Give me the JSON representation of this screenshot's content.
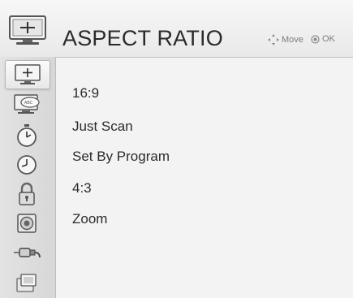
{
  "header": {
    "title": "ASPECT RATIO",
    "hint_move": "Move",
    "hint_ok": "OK",
    "icon": "picture-icon"
  },
  "sidebar": {
    "items": [
      {
        "icon": "picture-icon",
        "selected": true
      },
      {
        "icon": "audio-icon",
        "selected": false
      },
      {
        "icon": "timer-icon",
        "selected": false
      },
      {
        "icon": "clock-icon",
        "selected": false
      },
      {
        "icon": "lock-icon",
        "selected": false
      },
      {
        "icon": "speaker-icon",
        "selected": false
      },
      {
        "icon": "input-plug-icon",
        "selected": false
      },
      {
        "icon": "option-icon",
        "selected": false
      }
    ]
  },
  "options": [
    "16:9",
    "Just Scan",
    "Set By Program",
    "4:3",
    "Zoom"
  ],
  "colors": {
    "background": "#f2f2f2",
    "sidebar": "#dcdcdc",
    "text": "#2b2b2b",
    "hint": "#7d7d7d"
  }
}
